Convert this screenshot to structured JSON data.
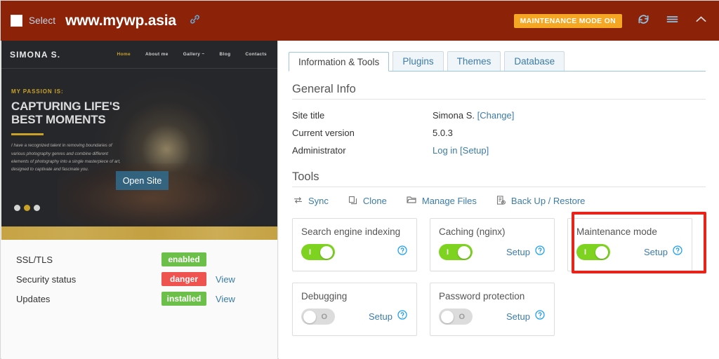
{
  "header": {
    "select_label": "Select",
    "site_name": "www.mywp.asia",
    "link_icon": "chain-link-icon",
    "maintenance_badge": "MAINTENANCE MODE ON",
    "refresh_icon": "refresh-icon",
    "menu_icon": "hamburger-menu-icon",
    "collapse_icon": "chevron-up-icon",
    "bg_color": "#8c2208",
    "badge_color": "#f5a623"
  },
  "preview": {
    "logo": "SIMONA S.",
    "nav": [
      {
        "label": "Home",
        "active": true
      },
      {
        "label": "About me",
        "active": false
      },
      {
        "label": "Gallery ~",
        "active": false
      },
      {
        "label": "Blog",
        "active": false
      },
      {
        "label": "Contacts",
        "active": false
      }
    ],
    "kicker": "MY PASSION IS:",
    "title_line1": "CAPTURING LIFE'S",
    "title_line2": "BEST MOMENTS",
    "description": "I have a recognized talent in removing boundaries of various photography genres and combine different elements of photography into a single masterpiece of art, designed to captivate and fascinate you.",
    "open_site_button": "Open Site",
    "accent_color": "#c9a227"
  },
  "status": {
    "rows": [
      {
        "label": "SSL/TLS",
        "pill": "enabled",
        "pill_type": "green",
        "link": ""
      },
      {
        "label": "Security status",
        "pill": "danger",
        "pill_type": "red",
        "link": "View"
      },
      {
        "label": "Updates",
        "pill": "installed",
        "pill_type": "green",
        "link": "View"
      }
    ],
    "green": "#6cc04a",
    "red": "#ef5350"
  },
  "tabs": [
    {
      "label": "Information & Tools",
      "active": true
    },
    {
      "label": "Plugins",
      "active": false
    },
    {
      "label": "Themes",
      "active": false
    },
    {
      "label": "Database",
      "active": false
    }
  ],
  "general_info": {
    "heading": "General Info",
    "rows": [
      {
        "key": "Site title",
        "value": "Simona S.",
        "link": "[Change]"
      },
      {
        "key": "Current version",
        "value": "5.0.3",
        "link": ""
      },
      {
        "key": "Administrator",
        "value": "",
        "link1": "Log in",
        "link": "[Setup]"
      }
    ]
  },
  "tools": {
    "heading": "Tools",
    "items": [
      {
        "label": "Sync",
        "icon": "sync-icon"
      },
      {
        "label": "Clone",
        "icon": "copy-icon"
      },
      {
        "label": "Manage Files",
        "icon": "folder-icon"
      },
      {
        "label": "Back Up / Restore",
        "icon": "backup-icon"
      }
    ]
  },
  "cards": [
    {
      "title": "Search engine indexing",
      "state": "on",
      "mark": "I",
      "setup": "",
      "help": "help-icon"
    },
    {
      "title": "Caching (nginx)",
      "state": "on",
      "mark": "I",
      "setup": "Setup",
      "help": "help-icon"
    },
    {
      "title": "Maintenance mode",
      "state": "on",
      "mark": "I",
      "setup": "Setup",
      "help": "help-icon",
      "highlighted": true
    },
    {
      "title": "Debugging",
      "state": "off",
      "mark": "O",
      "setup": "Setup",
      "help": "help-icon"
    },
    {
      "title": "Password protection",
      "state": "off",
      "mark": "O",
      "setup": "Setup",
      "help": "help-icon"
    }
  ],
  "highlight": {
    "color": "#e8231a",
    "target": "Maintenance mode"
  }
}
